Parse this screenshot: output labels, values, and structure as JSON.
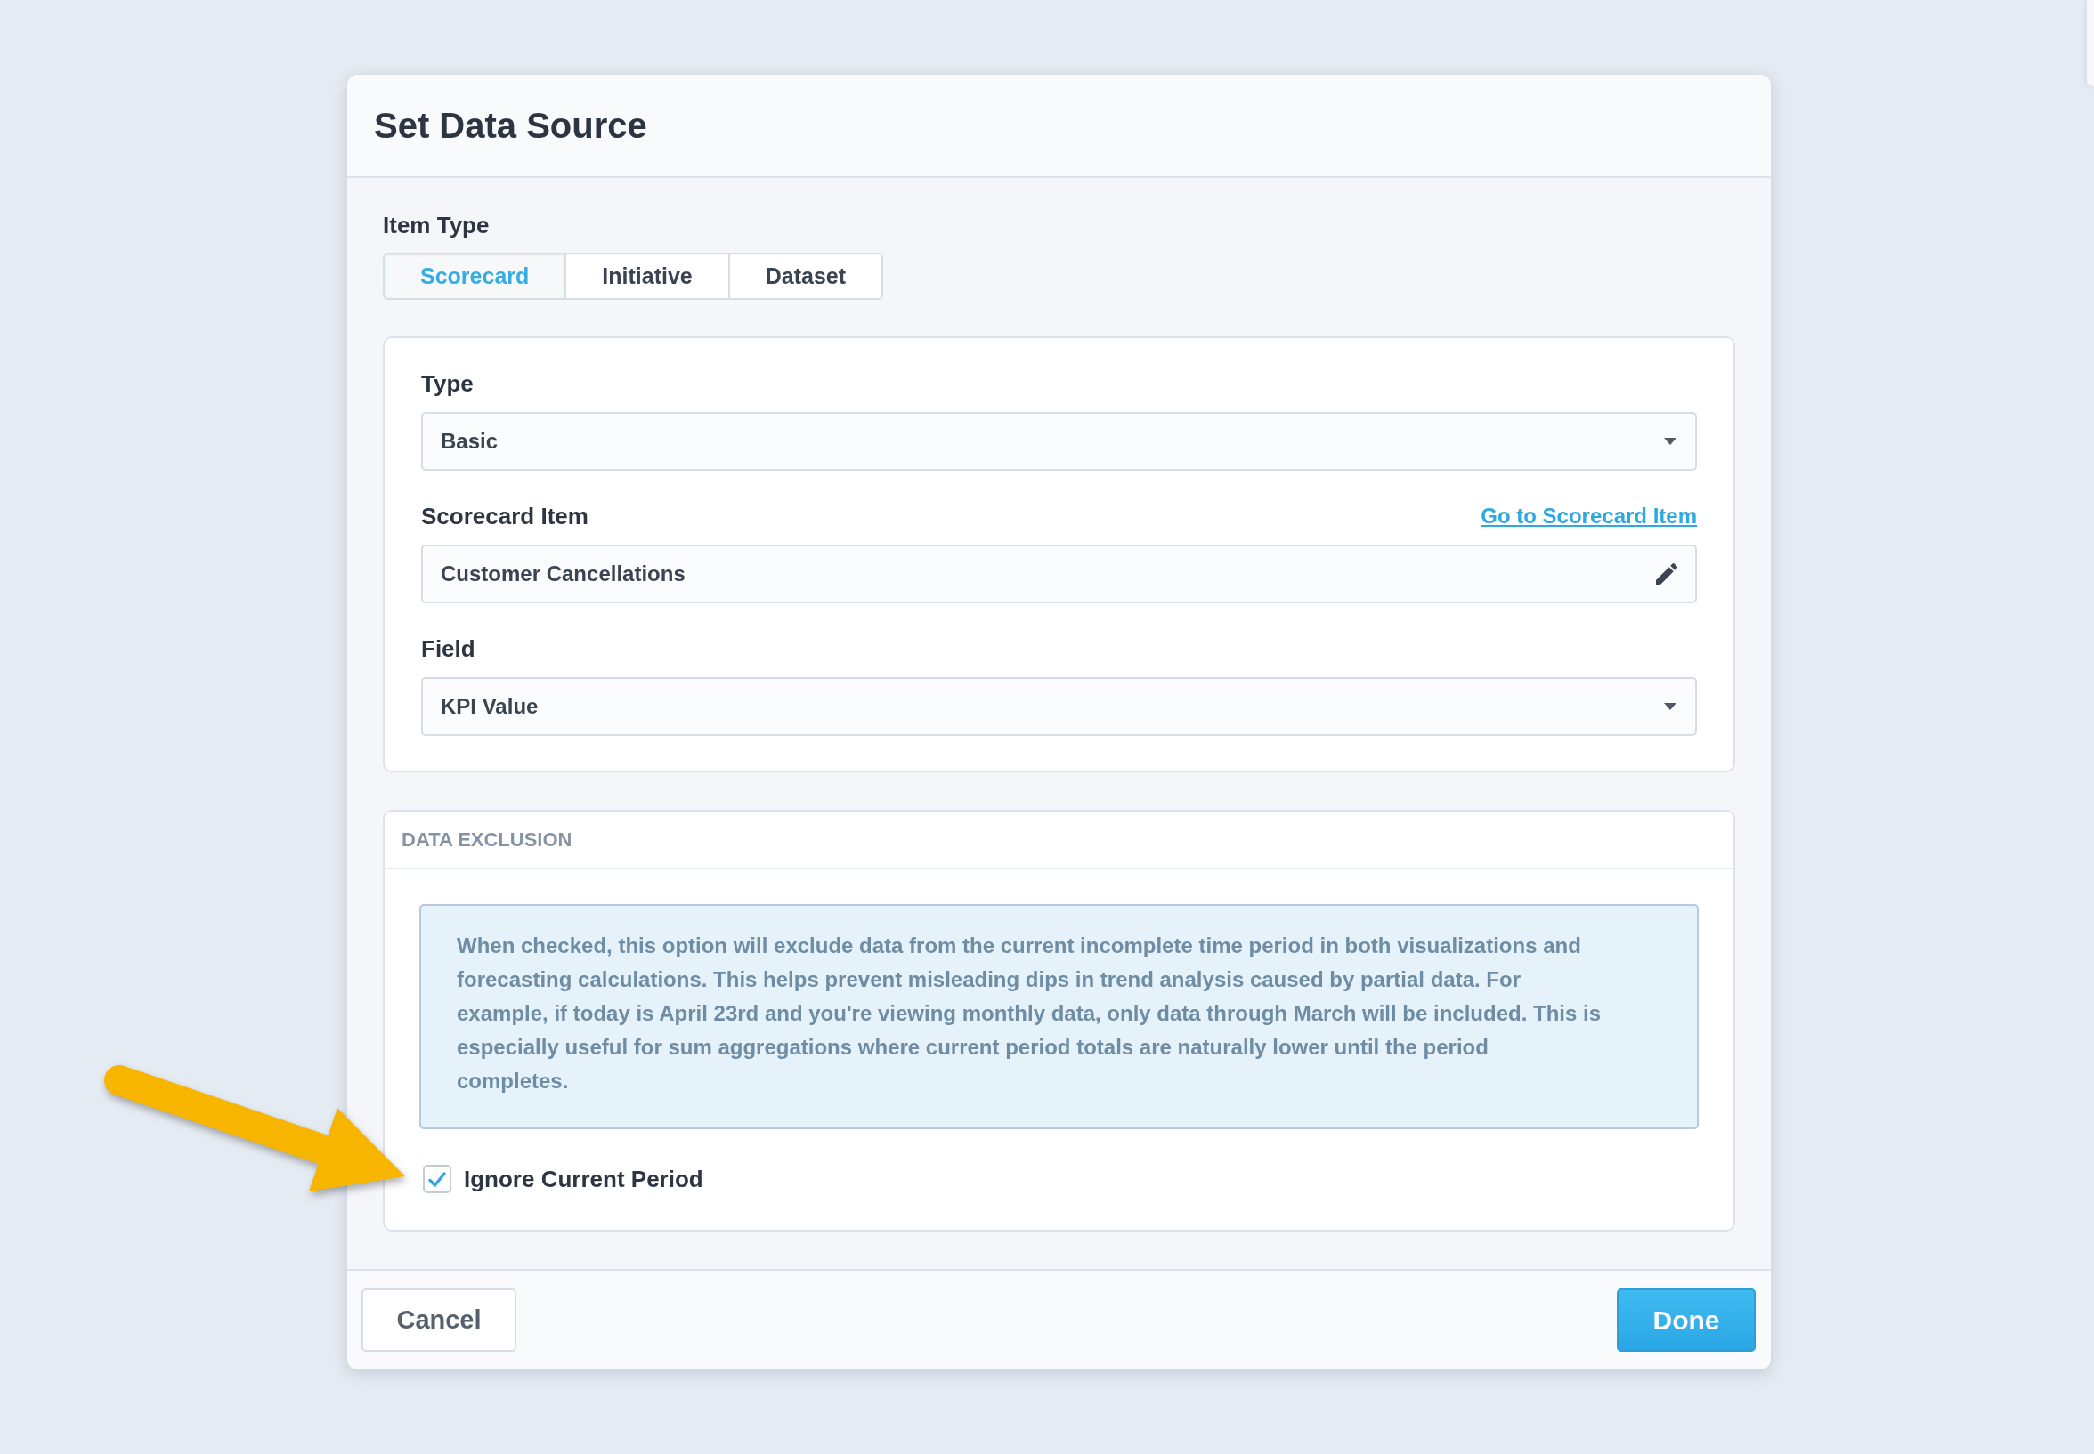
{
  "dialog": {
    "title": "Set Data Source",
    "item_type": {
      "label": "Item Type",
      "tabs": [
        {
          "label": "Scorecard",
          "selected": true
        },
        {
          "label": "Initiative",
          "selected": false
        },
        {
          "label": "Dataset",
          "selected": false
        }
      ]
    },
    "source": {
      "fields": [
        {
          "kind": "select",
          "label": "Type",
          "value": "Basic"
        },
        {
          "kind": "picker",
          "label": "Scorecard Item",
          "link": "Go to Scorecard Item",
          "value": "Customer Cancellations"
        },
        {
          "kind": "select",
          "label": "Field",
          "value": "KPI Value"
        }
      ]
    },
    "data_exclusion": {
      "heading": "DATA EXCLUSION",
      "info": "When checked, this option will exclude data from the current incomplete time period in both visualizations and forecasting calculations. This helps prevent misleading dips in trend analysis caused by partial data. For example, if today is April 23rd and you're viewing monthly data, only data through March will be included. This is especially useful for sum aggregations where current period totals are naturally lower until the period completes.",
      "option": {
        "label": "Ignore Current Period",
        "checked": true
      }
    },
    "buttons": [
      {
        "kind": "secondary",
        "label": "Cancel"
      },
      {
        "kind": "primary",
        "label": "Done"
      }
    ]
  }
}
